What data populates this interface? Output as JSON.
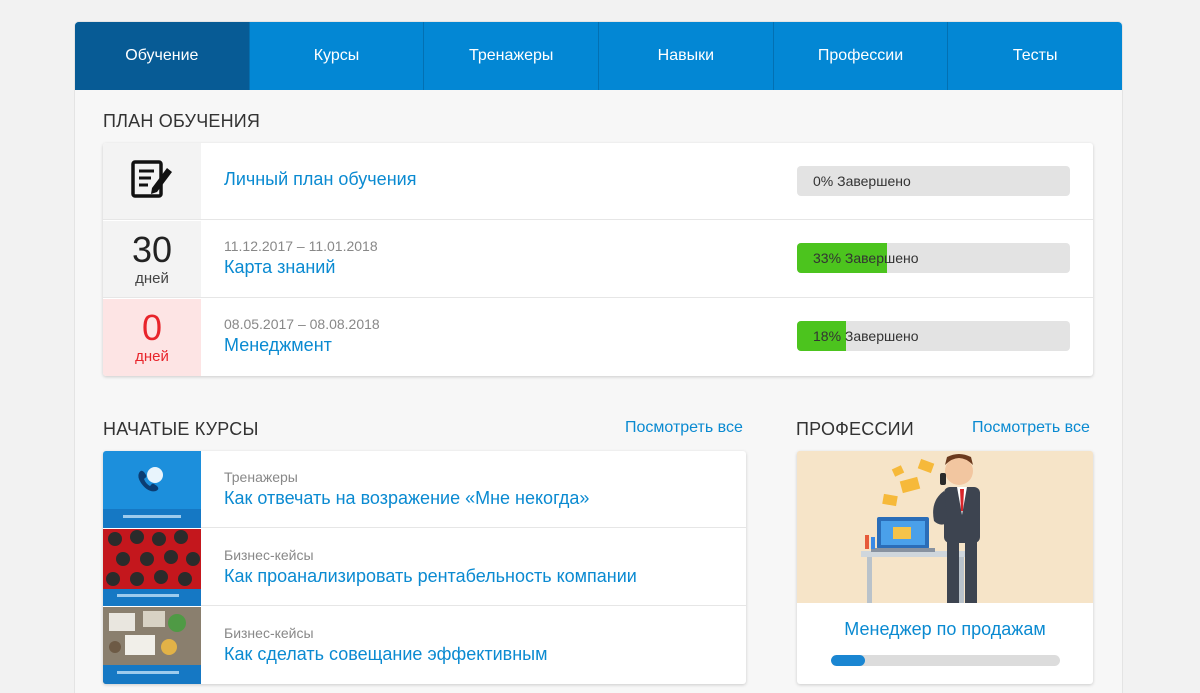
{
  "tabs": [
    {
      "label": "Обучение",
      "active": true
    },
    {
      "label": "Курсы"
    },
    {
      "label": "Тренажеры"
    },
    {
      "label": "Навыки"
    },
    {
      "label": "Профессии"
    },
    {
      "label": "Тесты"
    }
  ],
  "plan": {
    "title": "ПЛАН ОБУЧЕНИЯ",
    "rows": [
      {
        "icon": "edit-document-icon",
        "title": "Личный план обучения",
        "progress": 0,
        "progress_label": "0% Завершено"
      },
      {
        "days_count": "30",
        "days_label": "дней",
        "dates": "11.12.2017 – 11.01.2018",
        "title": "Карта знаний",
        "progress": 33,
        "progress_label": "33% Завершено"
      },
      {
        "days_count": "0",
        "days_label": "дней",
        "dates": "08.05.2017 – 08.08.2018",
        "title": "Менеджмент",
        "progress": 18,
        "progress_label": "18% Завершено"
      }
    ]
  },
  "courses": {
    "title": "НАЧАТЫЕ КУРСЫ",
    "see_all": "Посмотреть все",
    "items": [
      {
        "category": "Тренажеры",
        "title": "Как отвечать на возражение «Мне некогда»"
      },
      {
        "category": "Бизнес-кейсы",
        "title": "Как проанализировать рентабельность компании"
      },
      {
        "category": "Бизнес-кейсы",
        "title": "Как сделать совещание эффективным"
      }
    ]
  },
  "professions": {
    "title": "ПРОФЕССИИ",
    "see_all": "Посмотреть все",
    "card": {
      "name": "Менеджер по продажам",
      "progress": 15
    }
  },
  "colors": {
    "accent": "#0387d4",
    "active_tab": "#075b95",
    "progress_green": "#4cc41e",
    "link": "#0a8ad1",
    "alert_red": "#e8242b"
  }
}
